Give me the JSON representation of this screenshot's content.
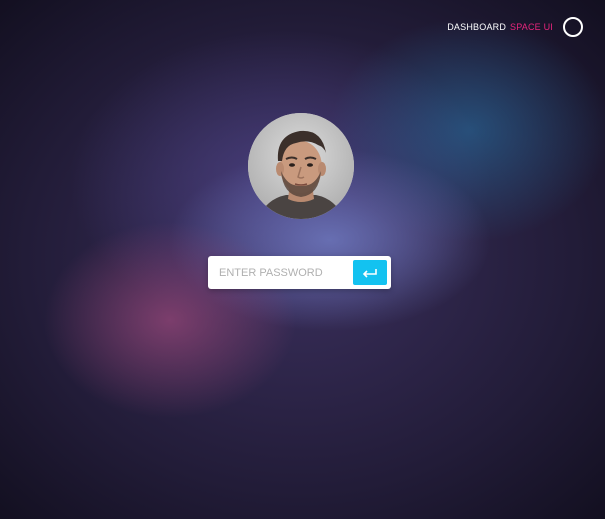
{
  "header": {
    "brand_primary": "DASHBOARD",
    "brand_accent": "SPACE UI",
    "power_icon": "power-circle-icon"
  },
  "user": {
    "avatar_icon": "user-avatar"
  },
  "login": {
    "password_placeholder": "ENTER PASSWORD",
    "password_value": "",
    "submit_icon": "enter-return-icon"
  },
  "colors": {
    "accent_pink": "#e8257c",
    "button_cyan": "#13c2f0",
    "text_white": "#ffffff"
  }
}
